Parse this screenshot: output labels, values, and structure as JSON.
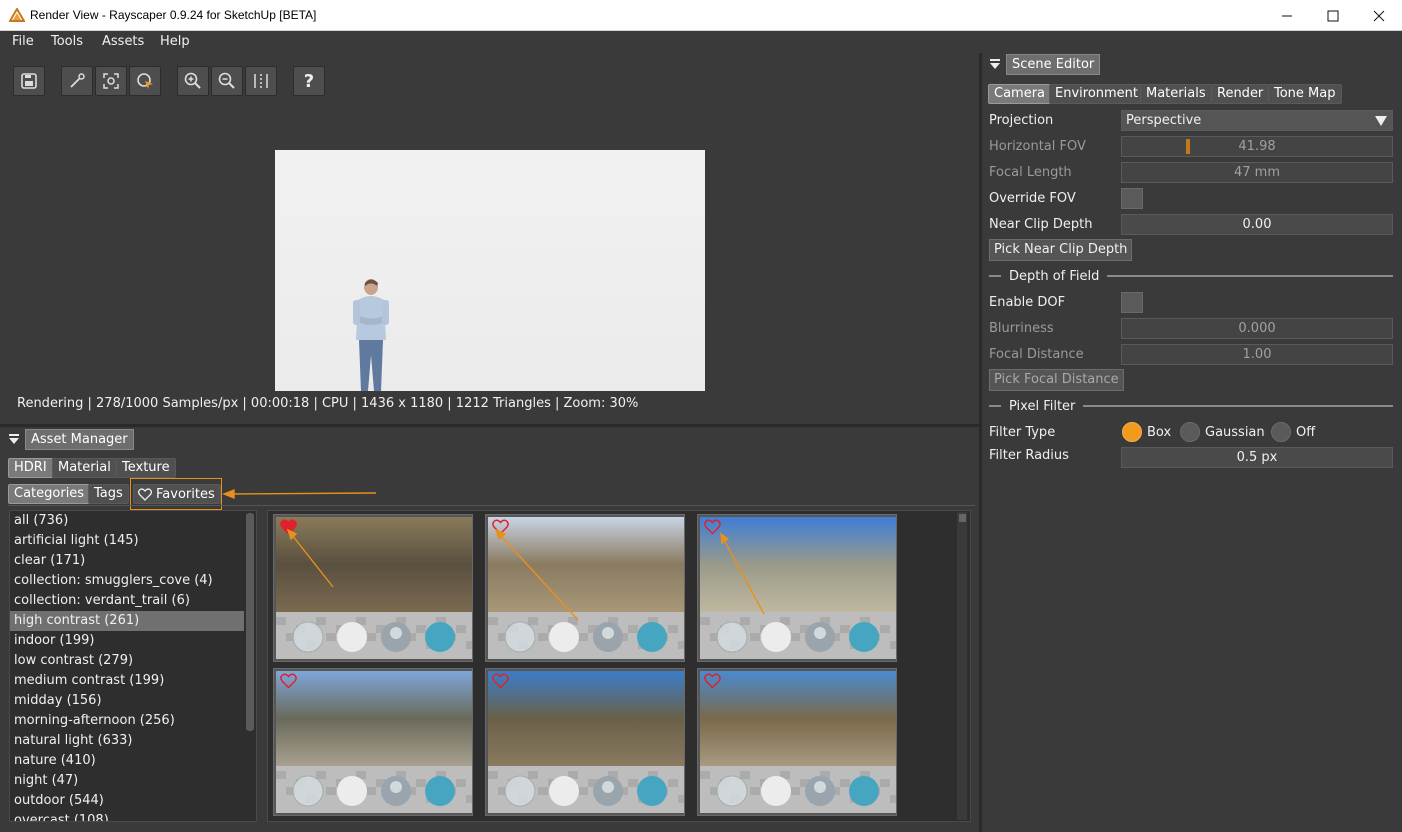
{
  "window": {
    "title": "Render View - Rayscaper 0.9.24 for SketchUp [BETA]",
    "minimize_icon": "minimize-icon",
    "maximize_icon": "maximize-icon",
    "close_icon": "close-icon"
  },
  "menu": {
    "file": "File",
    "tools": "Tools",
    "assets": "Assets",
    "help": "Help"
  },
  "toolbar": {
    "icons": [
      "save-icon",
      "eyedropper-icon",
      "focus-target-icon",
      "region-select-icon",
      "zoom-in-icon",
      "zoom-out-icon",
      "compare-split-icon",
      "help-icon"
    ],
    "help_label": "?"
  },
  "render": {
    "status": "Rendering | 278/1000 Samples/px | 00:00:18 | CPU | 1436 x 1180 | 1212 Triangles | Zoom: 30%"
  },
  "asset_manager": {
    "title": "Asset Manager",
    "tabs": [
      "HDRI",
      "Material",
      "Texture"
    ],
    "subtabs": {
      "categories": "Categories",
      "tags": "Tags",
      "favorites": "Favorites"
    },
    "categories": [
      "all (736)",
      "artificial light (145)",
      "clear (171)",
      "collection: smugglers_cove (4)",
      "collection: verdant_trail (6)",
      "high contrast (261)",
      "indoor (199)",
      "low contrast (279)",
      "medium contrast (199)",
      "midday (156)",
      "morning-afternoon (256)",
      "natural light (633)",
      "nature (410)",
      "night (47)",
      "outdoor (544)",
      "overcast (108)"
    ],
    "selected_category": "high contrast (261)",
    "hdri_thumbnails": [
      {
        "favorite": true
      },
      {
        "favorite": false
      },
      {
        "favorite": false
      },
      {
        "favorite": false
      },
      {
        "favorite": false
      },
      {
        "favorite": false
      }
    ],
    "heart_color": "#e0202a",
    "annotation_color": "#e8901e"
  },
  "scene_editor": {
    "title": "Scene Editor",
    "tabs": [
      "Camera",
      "Environment",
      "Materials",
      "Render",
      "Tone Map"
    ],
    "active_tab": "Camera",
    "projection": {
      "label": "Projection",
      "value": "Perspective"
    },
    "horizontal_fov": {
      "label": "Horizontal FOV",
      "value": "41.98",
      "slider_fraction": 0.24
    },
    "focal_length": {
      "label": "Focal Length",
      "value": "47 mm"
    },
    "override_fov": {
      "label": "Override FOV"
    },
    "near_clip": {
      "label": "Near Clip Depth",
      "value": "0.00"
    },
    "pick_near_clip": "Pick Near Clip Depth",
    "dof_section": "Depth of Field",
    "enable_dof": {
      "label": "Enable DOF"
    },
    "blurriness": {
      "label": "Blurriness",
      "value": "0.000"
    },
    "focal_distance": {
      "label": "Focal Distance",
      "value": "1.00"
    },
    "pick_focal_distance": "Pick Focal Distance",
    "pixel_filter_section": "Pixel Filter",
    "filter_type": {
      "label": "Filter Type",
      "options": [
        "Box",
        "Gaussian",
        "Off"
      ],
      "selected": "Box"
    },
    "filter_radius": {
      "label": "Filter Radius",
      "value": "0.5 px"
    },
    "accent": "#f29a1e"
  }
}
